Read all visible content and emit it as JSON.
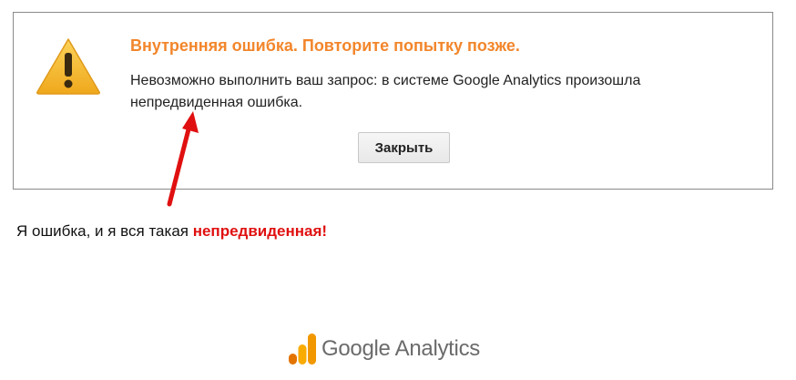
{
  "dialog": {
    "title": "Внутренняя ошибка. Повторите попытку позже.",
    "message": "Невозможно выполнить ваш запрос: в системе Google Analytics произошла непредвиденная ошибка.",
    "close_label": "Закрыть",
    "icon": "warning-icon"
  },
  "annotation": {
    "caption_prefix": "Я ошибка, и я вся такая ",
    "caption_highlight": "непредвиденная!",
    "arrow_color": "#e01010"
  },
  "branding": {
    "logo_text": "Google Analytics",
    "logo_icon": "google-analytics-icon"
  },
  "colors": {
    "title": "#f2862b",
    "highlight": "#e01010",
    "warning_fill": "#f5b82e"
  }
}
